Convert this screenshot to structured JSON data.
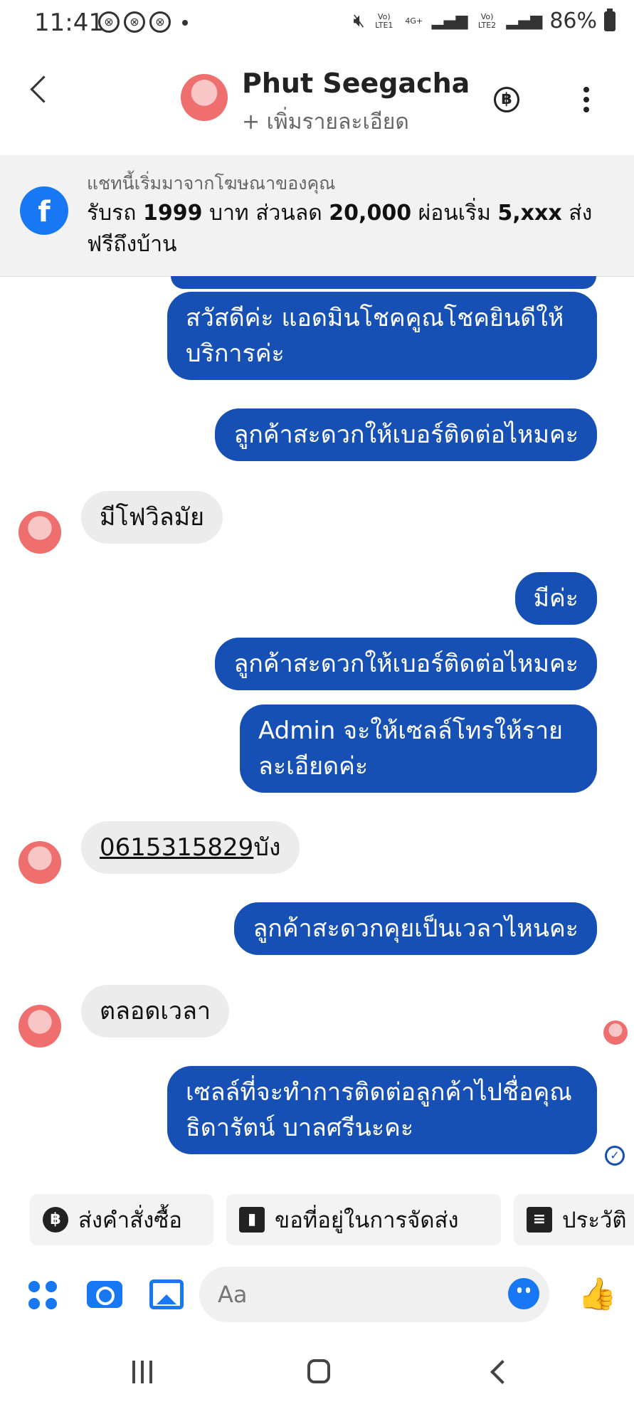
{
  "status_bar": {
    "time": "11:41",
    "notif_icons": [
      "⊗",
      "⊗",
      "⊗"
    ],
    "network_1": "Vo) LTE1",
    "network_g": "4G+",
    "network_2": "Vo) LTE2",
    "battery": "86%"
  },
  "header": {
    "name": "Phut Seegacha",
    "add_detail": "+ เพิ่มรายละเอียด",
    "baht_symbol": "฿"
  },
  "banner": {
    "sub": "แชทนี้เริ่มมาจากโฆษณาของคุณ",
    "text_parts": [
      "รับรถ ",
      "1999",
      " บาท ส่วนลด ",
      "20,000",
      " ผ่อนเริ่ม ",
      "5,xxx",
      " ส่งฟรีถึงบ้าน"
    ]
  },
  "messages": [
    {
      "dir": "out",
      "text": "สวัสดีค่ะ แอดมินโชคคูณโชคยินดีให้บริการค่ะ"
    },
    {
      "dir": "out",
      "text": "ลูกค้าสะดวกให้เบอร์ติดต่อไหมคะ"
    },
    {
      "dir": "in",
      "text": "มีโฟวิลมัย"
    },
    {
      "dir": "out",
      "text": "มีค่ะ"
    },
    {
      "dir": "out",
      "text": "ลูกค้าสะดวกให้เบอร์ติดต่อไหมคะ"
    },
    {
      "dir": "out",
      "text": "Admin จะให้เซลล์โทรให้รายละเอียดค่ะ"
    },
    {
      "dir": "in",
      "phone": "0615315829",
      "text": "บัง"
    },
    {
      "dir": "out",
      "text": "ลูกค้าสะดวกคุยเป็นเวลาไหนคะ"
    },
    {
      "dir": "in",
      "text": "ตลอดเวลา"
    },
    {
      "dir": "out",
      "text": "เซลล์ที่จะทำการติดต่อลูกค้าไปชื่อคุณธิดารัตน์ บาลศรีนะคะ"
    }
  ],
  "quick_replies": [
    {
      "icon": "baht-icon",
      "glyph": "฿",
      "label": "ส่งคำสั่งซื้อ"
    },
    {
      "icon": "map-icon",
      "glyph": "▮",
      "label": "ขอที่อยู่ในการจัดส่ง"
    },
    {
      "icon": "list-icon",
      "glyph": "≡",
      "label": "ประวัติ"
    }
  ],
  "composer": {
    "placeholder": "Aa",
    "like_glyph": "👍"
  },
  "colors": {
    "outgoing_bubble": "#1650b4",
    "incoming_bubble": "#ececec",
    "accent": "#1877f2"
  }
}
